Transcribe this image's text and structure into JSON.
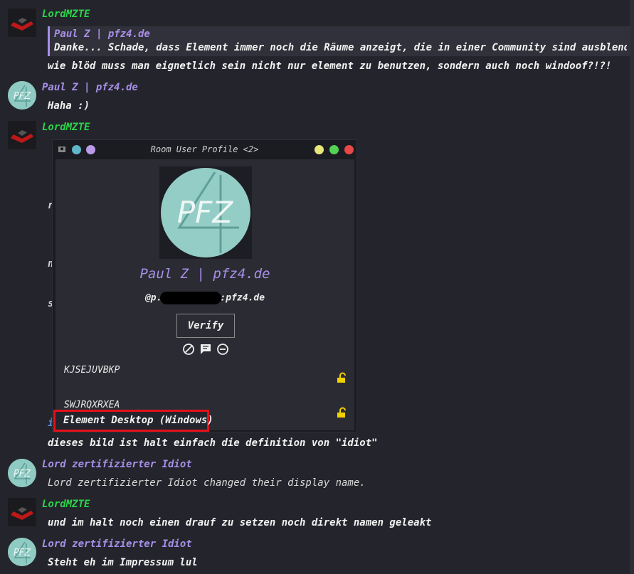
{
  "messages": [
    {
      "sender": "LordMZTE",
      "reply_sender": "Paul Z | pfz4.de",
      "reply_body": "Danke... Schade, dass Element immer noch die Räume anzeigt, die in einer Community sind ausblendet...",
      "body": "wie blöd muss man eignetlich sein nicht nur element zu benutzen, sondern auch noch windoof?!?!"
    },
    {
      "sender": "Paul Z | pfz4.de",
      "body": "Haha :)"
    },
    {
      "sender": "LordMZTE",
      "partial_1": "r",
      "partial_2": "n",
      "partial_3": "s",
      "partial_4": "i"
    },
    {
      "body": "dieses bild ist halt einfach die definition von \"idiot\""
    },
    {
      "sender": "Lord zertifizierter Idiot",
      "body": "Lord zertifizierter Idiot changed their display name."
    },
    {
      "sender": "LordMZTE",
      "body": "und im halt noch einen drauf zu setzen noch direkt namen geleakt"
    },
    {
      "sender": "Lord zertifizierter Idiot",
      "body": "Steht eh im Impressum lul"
    }
  ],
  "dialog": {
    "title": "Room User Profile <2>",
    "avatar_text": "PFZ",
    "display_name": "Paul Z | pfz4.de",
    "user_id_prefix": "@p.",
    "user_id_suffix": ":pfz4.de",
    "verify_label": "Verify",
    "devices": [
      {
        "id": "KJSEJUVBKP"
      },
      {
        "id": "SWJRQXRXEA"
      }
    ],
    "highlighted_device": "Element Desktop (Windows)"
  },
  "avatar_text": "PFZ",
  "colors": {
    "background": "#24252c",
    "green_user": "#2bd34a",
    "purple_user": "#a88fe8",
    "highlight_border": "#e3101b",
    "lock": "#f1d100"
  },
  "icons": [
    "ban-icon",
    "message-icon",
    "minus-icon",
    "unlock-icon"
  ]
}
